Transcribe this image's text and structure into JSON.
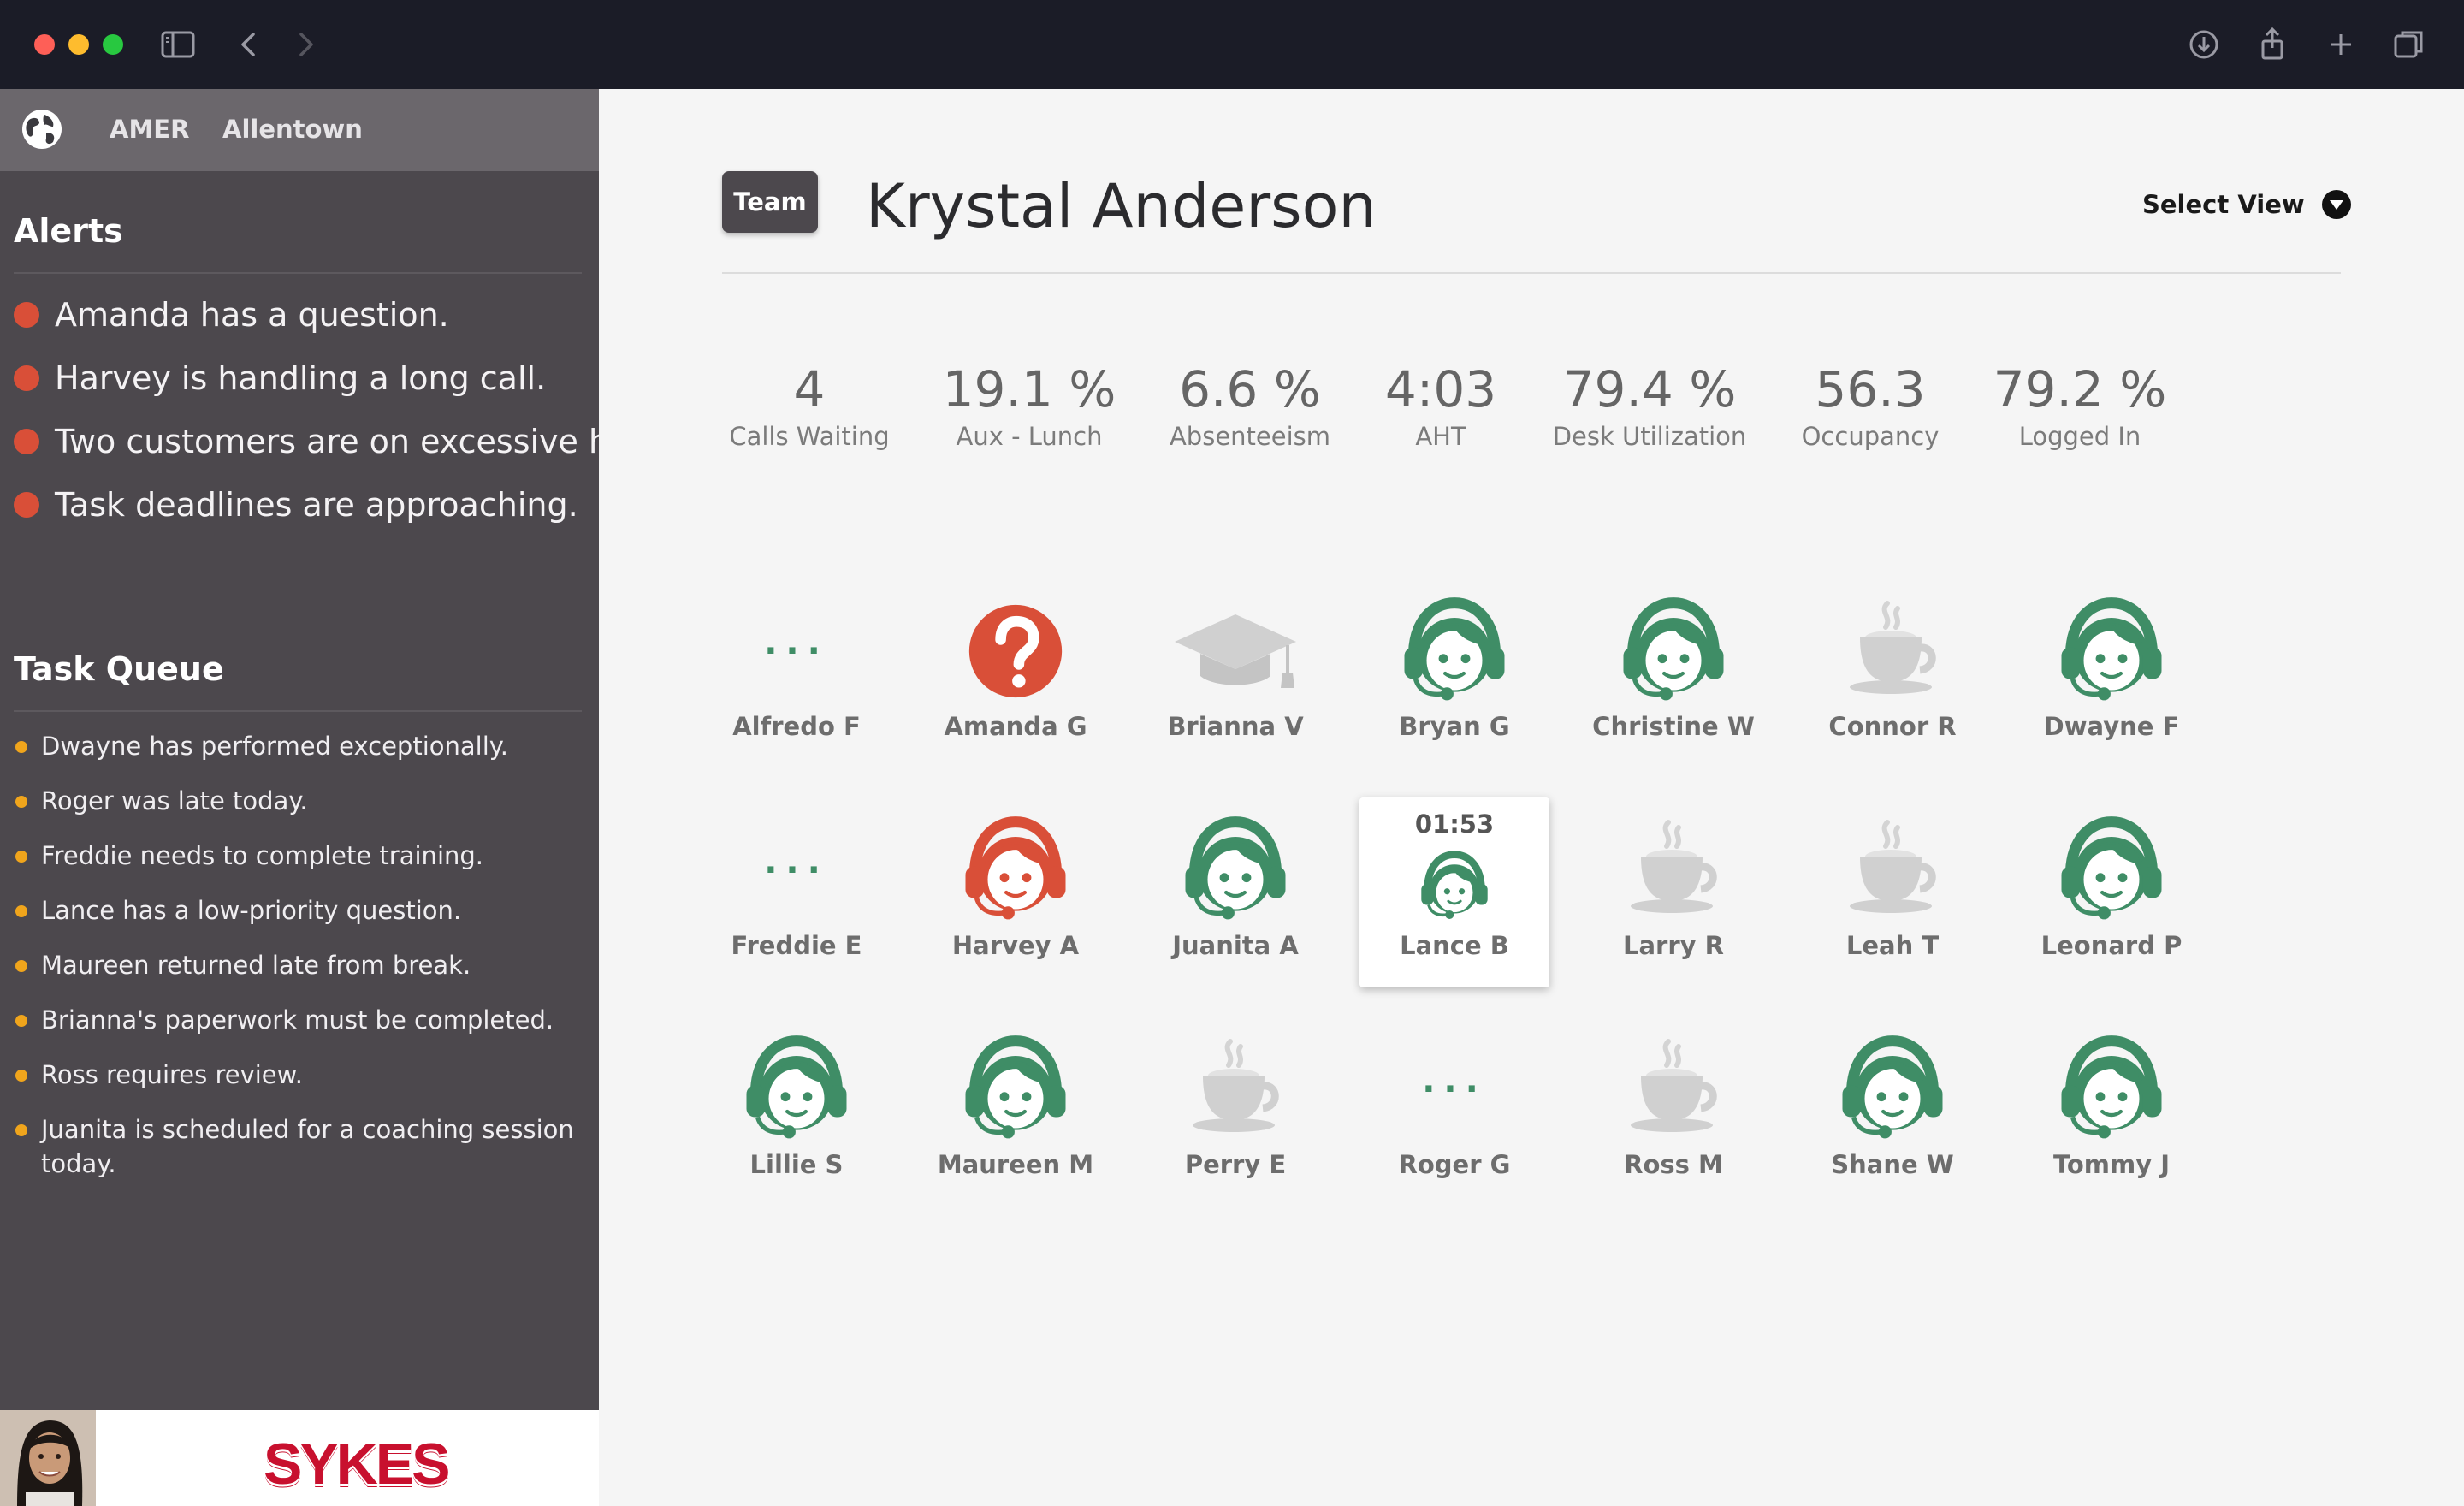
{
  "browser": {
    "icons": [
      "sidebar-toggle-icon",
      "back-icon",
      "forward-icon",
      "download-icon",
      "share-icon",
      "new-tab-icon",
      "tabs-overview-icon"
    ]
  },
  "sidebar": {
    "region": "AMER",
    "site": "Allentown",
    "alerts_title": "Alerts",
    "alerts": [
      "Amanda has a question.",
      "Harvey is handling a long call.",
      "Two customers are on excessive hold.",
      "Task deadlines are approaching."
    ],
    "task_queue_title": "Task Queue",
    "tasks": [
      "Dwayne has performed exceptionally.",
      "Roger was late today.",
      "Freddie needs to complete training.",
      "Lance has a low-priority question.",
      "Maureen returned late from break.",
      "Brianna's paperwork must be completed.",
      "Ross requires review.",
      "Juanita is scheduled for a coaching session today."
    ],
    "logo": "SYKES",
    "colors": {
      "alert_dot": "#d94f38",
      "task_dot": "#f0a51c"
    }
  },
  "header": {
    "badge": "Team",
    "supervisor": "Krystal Anderson",
    "select_view": "Select View"
  },
  "stats": [
    {
      "value": "4",
      "label": "Calls Waiting"
    },
    {
      "value": "19.1 %",
      "label": "Aux - Lunch"
    },
    {
      "value": "6.6 %",
      "label": "Absenteeism"
    },
    {
      "value": "4:03",
      "label": "AHT"
    },
    {
      "value": "79.4 %",
      "label": "Desk Utilization"
    },
    {
      "value": "56.3",
      "label": "Occupancy"
    },
    {
      "value": "79.2 %",
      "label": "Logged In"
    }
  ],
  "agents": [
    {
      "name": "Alfredo F",
      "status": "idle"
    },
    {
      "name": "Amanda G",
      "status": "question"
    },
    {
      "name": "Brianna V",
      "status": "training"
    },
    {
      "name": "Bryan G",
      "status": "on-call"
    },
    {
      "name": "Christine W",
      "status": "on-call"
    },
    {
      "name": "Connor R",
      "status": "break"
    },
    {
      "name": "Dwayne F",
      "status": "on-call"
    },
    {
      "name": "Freddie E",
      "status": "idle"
    },
    {
      "name": "Harvey A",
      "status": "long-call"
    },
    {
      "name": "Juanita A",
      "status": "on-call"
    },
    {
      "name": "Lance B",
      "status": "on-call",
      "timer": "01:53",
      "selected": true
    },
    {
      "name": "Larry R",
      "status": "break"
    },
    {
      "name": "Leah T",
      "status": "break"
    },
    {
      "name": "Leonard P",
      "status": "on-call"
    },
    {
      "name": "Lillie S",
      "status": "on-call"
    },
    {
      "name": "Maureen M",
      "status": "on-call"
    },
    {
      "name": "Perry E",
      "status": "break"
    },
    {
      "name": "Roger G",
      "status": "idle"
    },
    {
      "name": "Ross M",
      "status": "break"
    },
    {
      "name": "Shane W",
      "status": "on-call"
    },
    {
      "name": "Tommy J",
      "status": "on-call"
    }
  ],
  "status_icons": {
    "idle": "ellipsis-icon",
    "question": "question-mark-icon",
    "training": "graduation-cap-icon",
    "on-call": "headset-agent-icon",
    "long-call": "headset-agent-icon",
    "break": "coffee-cup-icon"
  },
  "colors": {
    "on_call": "#3f8d66",
    "alert": "#d94f38",
    "inactive": "#cfcfcf",
    "sidebar_bg": "#4c484d"
  }
}
